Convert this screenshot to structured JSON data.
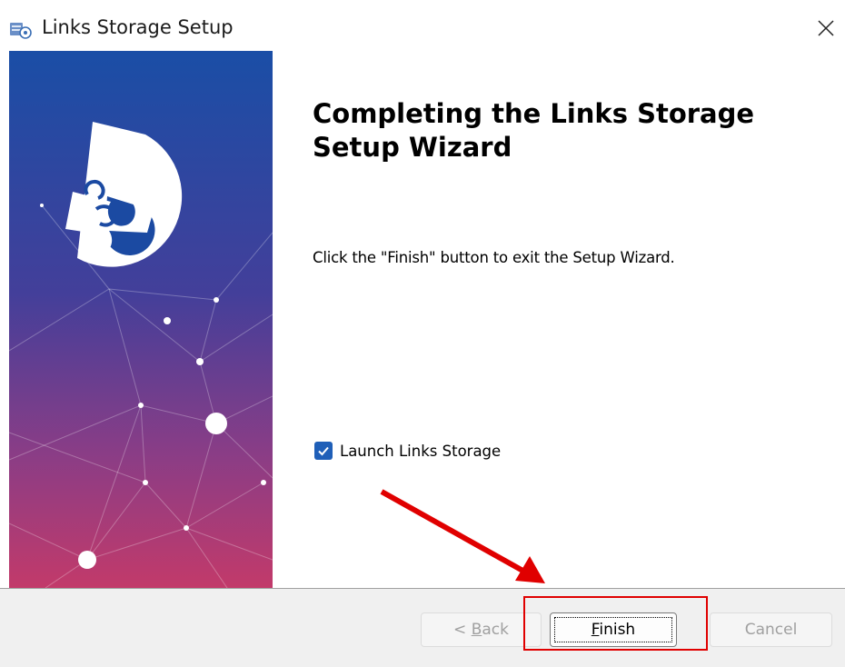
{
  "window": {
    "title": "Links Storage Setup",
    "close_icon": "close-icon",
    "app_icon": "setup-installer-icon"
  },
  "banner": {
    "image": "puzzle-piece-network-illustration",
    "gradient_top": "#1a4ea6",
    "gradient_bottom": "#c23a6a"
  },
  "content": {
    "heading": "Completing the Links Storage Setup Wizard",
    "body": "Click the \"Finish\" button to exit the Setup Wizard.",
    "launch_checkbox": {
      "label": "Launch Links Storage",
      "checked": true
    }
  },
  "footer": {
    "back_label_prefix": "< ",
    "back_label_key": "B",
    "back_label_rest": "ack",
    "finish_label_key": "F",
    "finish_label_rest": "inish",
    "cancel_label": "Cancel"
  },
  "annotation": {
    "color": "#e00000"
  }
}
